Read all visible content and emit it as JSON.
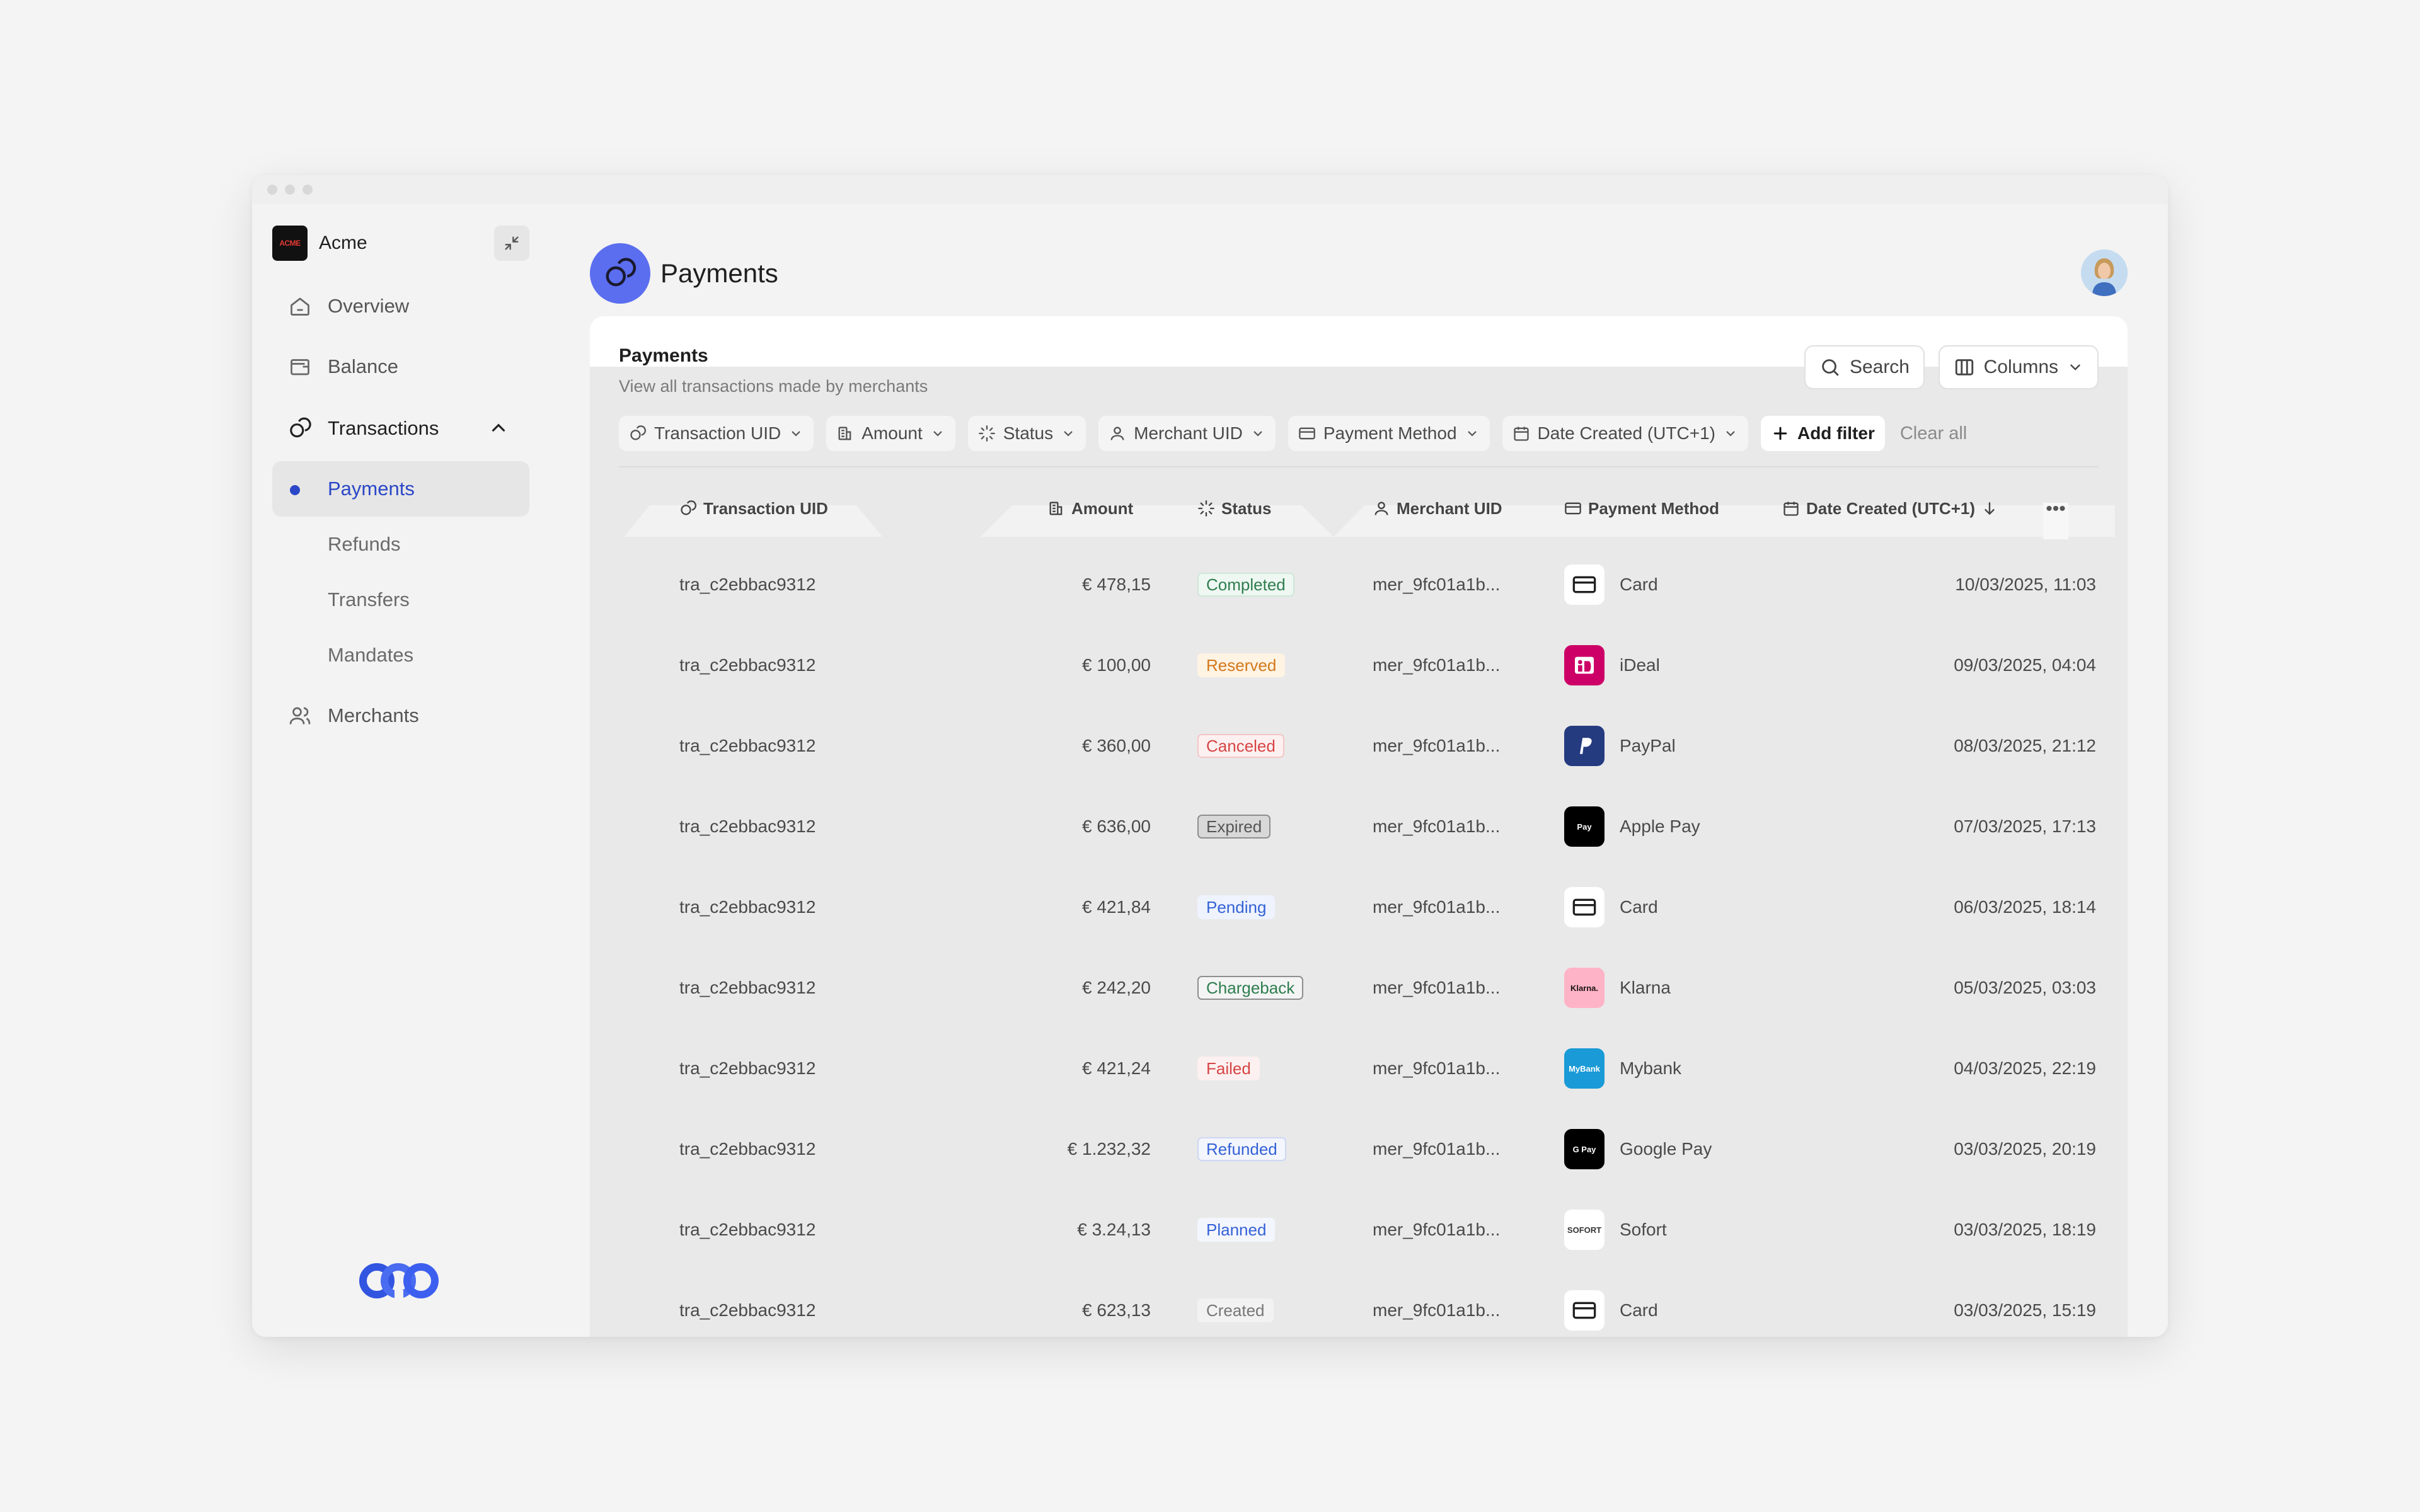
{
  "app": {
    "brand_name": "Acme",
    "brand_logo_text": "ACME"
  },
  "sidebar": {
    "items": [
      {
        "label": "Overview",
        "icon": "home-icon"
      },
      {
        "label": "Balance",
        "icon": "wallet-icon"
      },
      {
        "label": "Transactions",
        "icon": "transactions-icon",
        "expanded": true
      },
      {
        "label": "Merchants",
        "icon": "users-icon"
      }
    ],
    "sub_items": [
      {
        "label": "Payments",
        "active": true
      },
      {
        "label": "Refunds"
      },
      {
        "label": "Transfers"
      },
      {
        "label": "Mandates"
      }
    ]
  },
  "header": {
    "title": "Payments"
  },
  "card": {
    "title": "Payments",
    "subtitle": "View all transactions made by merchants",
    "search_label": "Search",
    "columns_label": "Columns"
  },
  "filters": [
    {
      "label": "Transaction UID",
      "icon": "link-icon"
    },
    {
      "label": "Amount",
      "icon": "coins-icon"
    },
    {
      "label": "Status",
      "icon": "loader-icon"
    },
    {
      "label": "Merchant UID",
      "icon": "user-icon"
    },
    {
      "label": "Payment Method",
      "icon": "credit-card-icon"
    },
    {
      "label": "Date Created  (UTC+1)",
      "icon": "calendar-icon"
    }
  ],
  "add_filter_label": "Add filter",
  "clear_all_label": "Clear all",
  "table": {
    "columns": [
      "Transaction UID",
      "Amount",
      "Status",
      "Merchant UID",
      "Payment Method",
      "Date Created  (UTC+1)"
    ],
    "sort": {
      "column": "Date Created  (UTC+1)",
      "direction": "desc"
    },
    "rows": [
      {
        "uid": "tra_c2ebbac9312",
        "amount": "€ 478,15",
        "status": "Completed",
        "merchant": "mer_9fc01a1b...",
        "method": "Card",
        "date": "10/03/2025, 11:03"
      },
      {
        "uid": "tra_c2ebbac9312",
        "amount": "€ 100,00",
        "status": "Reserved",
        "merchant": "mer_9fc01a1b...",
        "method": "iDeal",
        "date": "09/03/2025, 04:04"
      },
      {
        "uid": "tra_c2ebbac9312",
        "amount": "€ 360,00",
        "status": "Canceled",
        "merchant": "mer_9fc01a1b...",
        "method": "PayPal",
        "date": "08/03/2025, 21:12"
      },
      {
        "uid": "tra_c2ebbac9312",
        "amount": "€ 636,00",
        "status": "Expired",
        "merchant": "mer_9fc01a1b...",
        "method": "Apple Pay",
        "date": "07/03/2025, 17:13"
      },
      {
        "uid": "tra_c2ebbac9312",
        "amount": "€ 421,84",
        "status": "Pending",
        "merchant": "mer_9fc01a1b...",
        "method": "Card",
        "date": "06/03/2025, 18:14"
      },
      {
        "uid": "tra_c2ebbac9312",
        "amount": "€ 242,20",
        "status": "Chargeback",
        "merchant": "mer_9fc01a1b...",
        "method": "Klarna",
        "date": "05/03/2025, 03:03"
      },
      {
        "uid": "tra_c2ebbac9312",
        "amount": "€ 421,24",
        "status": "Failed",
        "merchant": "mer_9fc01a1b...",
        "method": "Mybank",
        "date": "04/03/2025, 22:19"
      },
      {
        "uid": "tra_c2ebbac9312",
        "amount": "€ 1.232,32",
        "status": "Refunded",
        "merchant": "mer_9fc01a1b...",
        "method": "Google Pay",
        "date": "03/03/2025, 20:19"
      },
      {
        "uid": "tra_c2ebbac9312",
        "amount": "€ 3.24,13",
        "status": "Planned",
        "merchant": "mer_9fc01a1b...",
        "method": "Sofort",
        "date": "03/03/2025, 18:19"
      },
      {
        "uid": "tra_c2ebbac9312",
        "amount": "€ 623,13",
        "status": "Created",
        "merchant": "mer_9fc01a1b...",
        "method": "Card",
        "date": "03/03/2025, 15:19"
      }
    ]
  },
  "status_colors": {
    "Completed": {
      "fg": "#2e7d4f",
      "bg": "#eef7f1",
      "border": "#cfe6d8"
    },
    "Reserved": {
      "fg": "#d3781b",
      "bg": "#fff3e3",
      "border": "#fff3e3"
    },
    "Canceled": {
      "fg": "#d64545",
      "bg": "#fdf0f0",
      "border": "#f3c6c6"
    },
    "Expired": {
      "fg": "#555555",
      "bg": "#d8d8d8",
      "border": "#8e8e8e"
    },
    "Pending": {
      "fg": "#3462d6",
      "bg": "#eef3fd",
      "border": "#eef3fd"
    },
    "Chargeback": {
      "fg": "#2e7d4f",
      "bg": "#f4f4f4",
      "border": "#8e8e8e"
    },
    "Failed": {
      "fg": "#d64545",
      "bg": "#fdf0f0",
      "border": "#fdf0f0"
    },
    "Refunded": {
      "fg": "#3462d6",
      "bg": "#f4f6fd",
      "border": "#cdd7f4"
    },
    "Planned": {
      "fg": "#3462d6",
      "bg": "#f4f6fd",
      "border": "#f4f6fd"
    },
    "Created": {
      "fg": "#777777",
      "bg": "#f2f2f2",
      "border": "#f2f2f2"
    }
  },
  "payment_methods": {
    "Card": {
      "icon": "credit-card-icon",
      "bg": "#ffffff",
      "fg": "#222222",
      "glyph": ""
    },
    "iDeal": {
      "icon": "ideal-logo-icon",
      "bg": "#cc0066",
      "fg": "#ffffff",
      "glyph": ""
    },
    "PayPal": {
      "icon": "paypal-logo-icon",
      "bg": "#253b80",
      "fg": "#ffffff",
      "glyph": ""
    },
    "Apple Pay": {
      "icon": "apple-pay-logo-icon",
      "bg": "#000000",
      "fg": "#ffffff",
      "glyph": "Pay"
    },
    "Klarna": {
      "icon": "klarna-logo-icon",
      "bg": "#ffb3c7",
      "fg": "#17120f",
      "glyph": "Klarna."
    },
    "Mybank": {
      "icon": "mybank-logo-icon",
      "bg": "#1a9ad6",
      "fg": "#ffffff",
      "glyph": "MyBank"
    },
    "Google Pay": {
      "icon": "google-pay-logo-icon",
      "bg": "#000000",
      "fg": "#ffffff",
      "glyph": "G Pay"
    },
    "Sofort": {
      "icon": "sofort-logo-icon",
      "bg": "#ffffff",
      "fg": "#333333",
      "glyph": "SOFORT"
    }
  },
  "colors": {
    "accent": "#2b47c7",
    "page_icon": "#5b6ef0"
  }
}
